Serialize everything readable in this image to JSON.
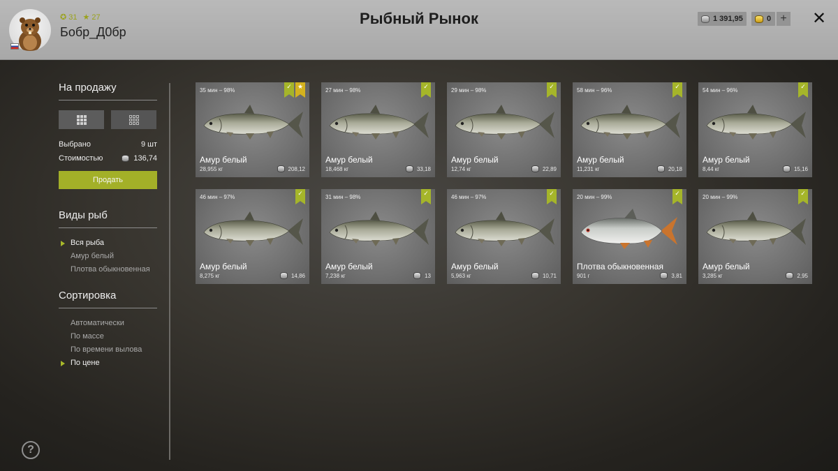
{
  "header": {
    "title": "Рыбный Рынок",
    "username": "Бобр_Д0бр",
    "level": "31",
    "rank": "27",
    "silver": "1 391,95",
    "gold": "0",
    "add_label": "+",
    "close_label": "✕"
  },
  "sidebar": {
    "sale_title": "На продажу",
    "selected_label": "Выбрано",
    "selected_value": "9 шт",
    "cost_label": "Стоимостью",
    "cost_value": "136,74",
    "sell_label": "Продать",
    "species_title": "Виды рыб",
    "species": [
      {
        "label": "Вся рыба",
        "active": true
      },
      {
        "label": "Амур белый",
        "active": false
      },
      {
        "label": "Плотва обыкновенная",
        "active": false
      }
    ],
    "sort_title": "Сортировка",
    "sort": [
      {
        "label": "Автоматически",
        "active": false
      },
      {
        "label": "По массе",
        "active": false
      },
      {
        "label": "По времени вылова",
        "active": false
      },
      {
        "label": "По цене",
        "active": true
      }
    ]
  },
  "colors": {
    "accent": "#a3b028",
    "gold_badge": "#d4b21f"
  },
  "icons": [
    "avatar-beaver",
    "level-icon",
    "star-icon",
    "silver-coin-icon",
    "gold-coin-icon",
    "check-icon",
    "grid-large-icon",
    "grid-small-icon",
    "help-icon"
  ],
  "fish_cards": [
    {
      "meta": "35 мин – 98%",
      "name": "Амур белый",
      "weight": "28,955 кг",
      "price": "208,12",
      "checked": true,
      "starred": true,
      "kind": "amur"
    },
    {
      "meta": "27 мин – 98%",
      "name": "Амур белый",
      "weight": "18,468 кг",
      "price": "33,18",
      "checked": true,
      "starred": false,
      "kind": "amur"
    },
    {
      "meta": "29 мин – 98%",
      "name": "Амур белый",
      "weight": "12,74 кг",
      "price": "22,89",
      "checked": true,
      "starred": false,
      "kind": "amur"
    },
    {
      "meta": "58 мин – 96%",
      "name": "Амур белый",
      "weight": "11,231 кг",
      "price": "20,18",
      "checked": true,
      "starred": false,
      "kind": "amur"
    },
    {
      "meta": "54 мин – 96%",
      "name": "Амур белый",
      "weight": "8,44 кг",
      "price": "15,16",
      "checked": true,
      "starred": false,
      "kind": "amur"
    },
    {
      "meta": "46 мин – 97%",
      "name": "Амур белый",
      "weight": "8,275 кг",
      "price": "14,86",
      "checked": true,
      "starred": false,
      "kind": "amur"
    },
    {
      "meta": "31 мин – 98%",
      "name": "Амур белый",
      "weight": "7,238 кг",
      "price": "13",
      "checked": true,
      "starred": false,
      "kind": "amur"
    },
    {
      "meta": "46 мин – 97%",
      "name": "Амур белый",
      "weight": "5,963 кг",
      "price": "10,71",
      "checked": true,
      "starred": false,
      "kind": "amur"
    },
    {
      "meta": "20 мин – 99%",
      "name": "Плотва обыкновенная",
      "weight": "901 г",
      "price": "3,81",
      "checked": true,
      "starred": false,
      "kind": "roach"
    },
    {
      "meta": "20 мин – 99%",
      "name": "Амур белый",
      "weight": "3,285 кг",
      "price": "2,95",
      "checked": true,
      "starred": false,
      "kind": "amur"
    }
  ]
}
